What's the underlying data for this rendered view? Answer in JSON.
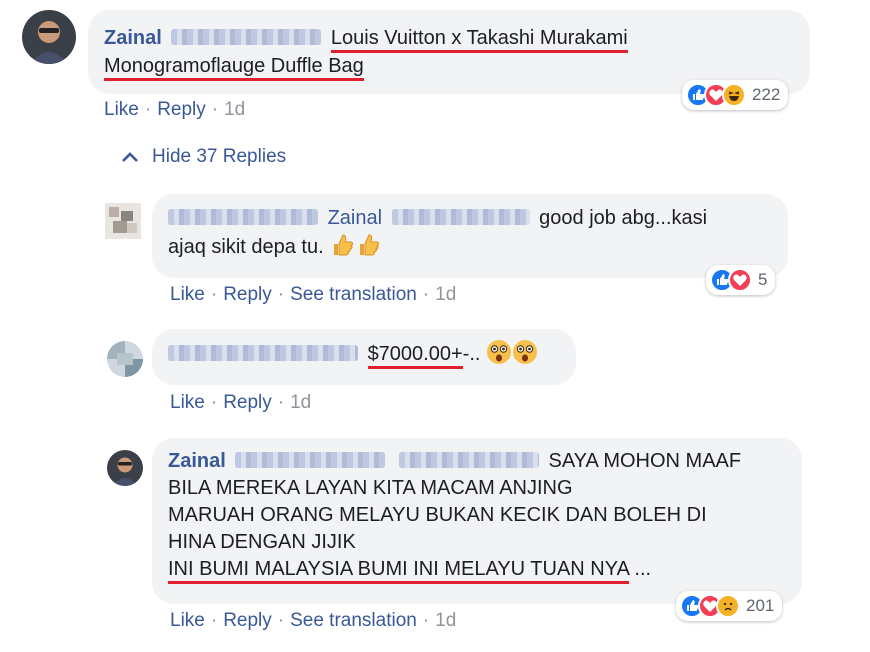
{
  "main_comment": {
    "author": "Zainal",
    "text_line1": "Louis Vuitton x Takashi Murakami",
    "text_line2": "Monogramoflauge Duffle Bag",
    "like": "Like",
    "reply": "Reply",
    "time": "1d",
    "reaction_count": "222"
  },
  "hide_replies": {
    "label": "Hide 37 Replies"
  },
  "replies": [
    {
      "tag": "Zainal",
      "text_a": "good job abg...kasi",
      "text_b": "ajaq sikit depa tu.",
      "like": "Like",
      "reply": "Reply",
      "see_translation": "See translation",
      "time": "1d",
      "reaction_count": "5"
    },
    {
      "price": "$7000.00+",
      "suffix": "-..",
      "like": "Like",
      "reply": "Reply",
      "time": "1d"
    },
    {
      "author": "Zainal",
      "line1": "SAYA MOHON MAAF",
      "line2": "BILA MEREKA LAYAN KITA MACAM ANJING",
      "line3": "MARUAH ORANG MELAYU BUKAN KECIK DAN BOLEH DI",
      "line4": "HINA DENGAN JIJIK",
      "line5": "INI BUMI MALAYSIA BUMI INI MELAYU TUAN NYA",
      "more": "...",
      "like": "Like",
      "reply": "Reply",
      "see_translation": "See translation",
      "time": "1d",
      "reaction_count": "201"
    }
  ],
  "colors": {
    "link": "#385898",
    "underline": "#e0202e",
    "bubble": "#f2f3f5"
  },
  "icons": [
    "like-icon",
    "love-icon",
    "haha-icon",
    "sad-icon",
    "thumbs-up-emoji",
    "astonished-emoji",
    "chevron-up-icon"
  ]
}
